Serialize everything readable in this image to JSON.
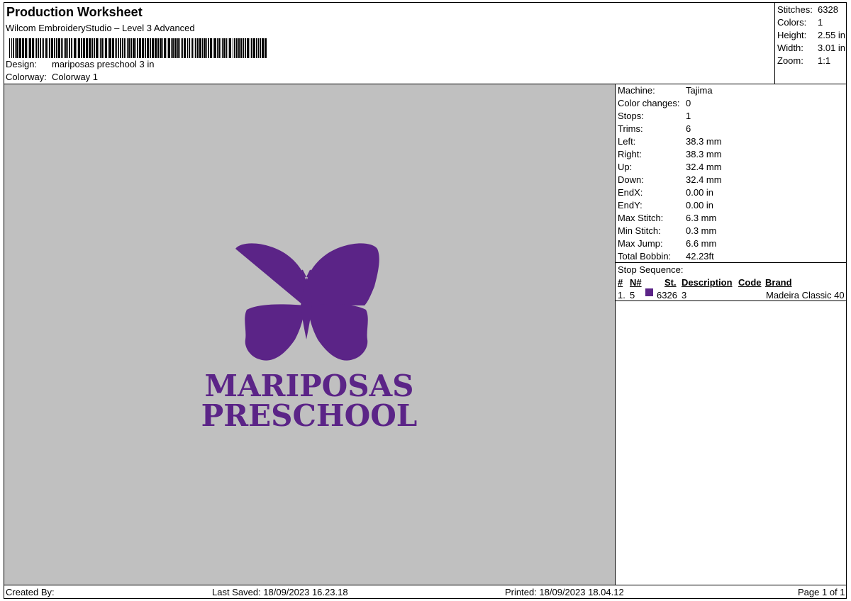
{
  "header": {
    "title": "Production Worksheet",
    "software": "Wilcom EmbroideryStudio – Level 3 Advanced",
    "design_label": "Design:",
    "design_value": "mariposas preschool 3 in",
    "colorway_label": "Colorway:",
    "colorway_value": "Colorway 1"
  },
  "summary": {
    "stitches_label": "Stitches:",
    "stitches_value": "6328",
    "colors_label": "Colors:",
    "colors_value": "1",
    "height_label": "Height:",
    "height_value": "2.55 in",
    "width_label": "Width:",
    "width_value": "3.01 in",
    "zoom_label": "Zoom:",
    "zoom_value": "1:1"
  },
  "design_preview": {
    "line1": "MARIPOSAS",
    "line2": "PRESCHOOL",
    "thread_color": "#5b2487",
    "background_color": "#c0c0c0"
  },
  "properties": [
    {
      "label": "Machine:",
      "value": "Tajima"
    },
    {
      "label": "Color changes:",
      "value": "0"
    },
    {
      "label": "Stops:",
      "value": "1"
    },
    {
      "label": "Trims:",
      "value": "6"
    },
    {
      "label": "Left:",
      "value": "38.3 mm"
    },
    {
      "label": "Right:",
      "value": "38.3 mm"
    },
    {
      "label": "Up:",
      "value": "32.4 mm"
    },
    {
      "label": "Down:",
      "value": "32.4 mm"
    },
    {
      "label": "EndX:",
      "value": "0.00 in"
    },
    {
      "label": "EndY:",
      "value": "0.00 in"
    },
    {
      "label": "Max Stitch:",
      "value": "6.3 mm"
    },
    {
      "label": "Min Stitch:",
      "value": "0.3 mm"
    },
    {
      "label": "Max Jump:",
      "value": "6.6 mm"
    },
    {
      "label": "Total Bobbin:",
      "value": "42.23ft"
    }
  ],
  "stop_sequence": {
    "title": "Stop Sequence:",
    "columns": {
      "num": "#",
      "n": "N#",
      "st": "St.",
      "description": "Description",
      "code": "Code",
      "brand": "Brand"
    },
    "rows": [
      {
        "num": "1.",
        "n": "5",
        "st": "6326",
        "description": "3",
        "code": "",
        "brand": "Madeira Classic 40",
        "color": "#5b2487"
      }
    ]
  },
  "footer": {
    "created_by": "Created By:",
    "last_saved": "Last Saved: 18/09/2023 16.23.18",
    "printed": "Printed: 18/09/2023 18.04.12",
    "page": "Page 1 of 1"
  }
}
